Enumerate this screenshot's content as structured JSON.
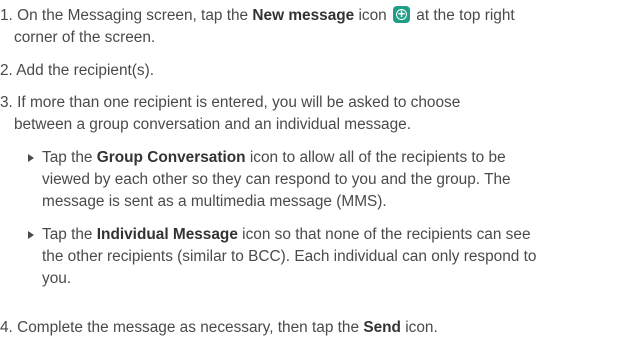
{
  "steps": [
    {
      "num": "1.",
      "line1_a": "On the Messaging screen, tap the ",
      "line1_b": "New message",
      "line1_c": " icon ",
      "line1_d": " at the top right",
      "line2": "corner of the screen."
    },
    {
      "num": "2.",
      "text": "Add the recipient(s)."
    },
    {
      "num": "3.",
      "line1": "If more than one recipient is entered, you will be asked to choose",
      "line2": "between a group conversation and an individual message."
    },
    {
      "num": "4.",
      "line1_a": "Complete the message as necessary, then tap the ",
      "line1_b": "Send",
      "line1_c": " icon."
    }
  ],
  "bullets": [
    {
      "line1_a": "Tap the ",
      "line1_b": "Group Conversation",
      "line1_c": " icon to allow all of the recipients to be",
      "line2": "viewed by each other so they can respond to you and the group. The",
      "line3": "message is sent as a multimedia message (MMS)."
    },
    {
      "line1_a": "Tap the ",
      "line1_b": "Individual Message",
      "line1_c": " icon so that none of the recipients can see",
      "line2": "the other recipients (similar to BCC). Each individual can only respond to",
      "line3": "you."
    }
  ],
  "icons": {
    "new_message": "plus-circle-icon",
    "new_message_color": "#1f9e84",
    "bullet": "triangle-right-icon"
  }
}
